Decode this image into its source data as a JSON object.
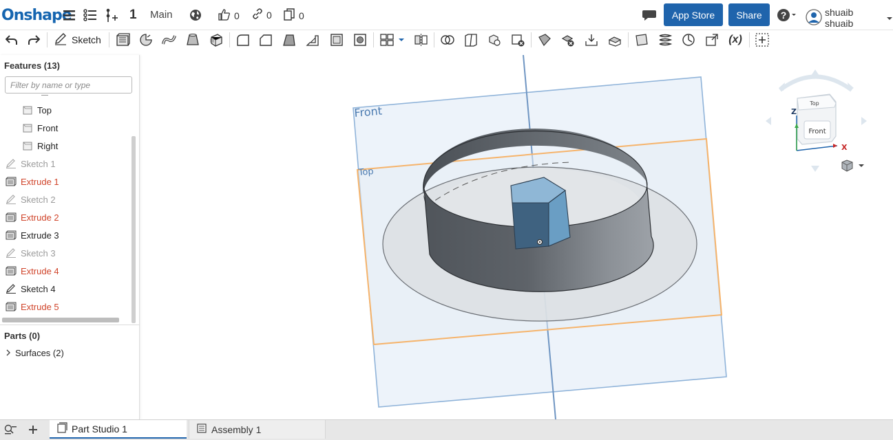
{
  "topbar": {
    "logo": "Onshape",
    "version_count": "1",
    "branch": "Main",
    "likes": "0",
    "links": "0",
    "copies": "0",
    "app_store_label": "App Store",
    "share_label": "Share",
    "user_name": "shuaib shuaib"
  },
  "toolbar": {
    "sketch_label": "Sketch",
    "tools": [
      "undo-icon",
      "redo-icon",
      "plane-icon",
      "revolve-icon",
      "sweep-icon",
      "loft-icon",
      "thicken-icon",
      "fillet-icon",
      "chamfer-icon",
      "draft-icon",
      "rib-icon",
      "shell-icon",
      "hole-icon",
      "pattern-icon",
      "mirror-icon",
      "boolean-icon",
      "split-icon",
      "transform-icon",
      "delete-part-icon",
      "modify-fillet-icon",
      "delete-face-icon",
      "move-face-icon",
      "replace-face-icon",
      "plane-tool-icon",
      "helix-icon",
      "mate-connector-icon",
      "import-icon",
      "variable-icon",
      "add-custom-feature-icon"
    ]
  },
  "panel": {
    "features_title": "Features (13)",
    "filter_placeholder": "Filter by name or type",
    "planes": [
      {
        "label": "Top"
      },
      {
        "label": "Front"
      },
      {
        "label": "Right"
      }
    ],
    "features": [
      {
        "label": "Sketch 1",
        "kind": "sketch",
        "color": "#9a9a9a"
      },
      {
        "label": "Extrude 1",
        "kind": "extrude",
        "color": "#d0442a"
      },
      {
        "label": "Sketch 2",
        "kind": "sketch",
        "color": "#9a9a9a"
      },
      {
        "label": "Extrude 2",
        "kind": "extrude",
        "color": "#d0442a"
      },
      {
        "label": "Extrude 3",
        "kind": "extrude",
        "color": "#222222"
      },
      {
        "label": "Sketch 3",
        "kind": "sketch",
        "color": "#9a9a9a"
      },
      {
        "label": "Extrude 4",
        "kind": "extrude",
        "color": "#d0442a"
      },
      {
        "label": "Sketch 4",
        "kind": "sketch",
        "color": "#222222"
      },
      {
        "label": "Extrude 5",
        "kind": "extrude",
        "color": "#d0442a"
      }
    ],
    "parts_title": "Parts (0)",
    "surfaces_label": "Surfaces (2)"
  },
  "viewport": {
    "front_plane_label": "Front",
    "top_plane_label": "Top",
    "viewcube_top": "Top",
    "viewcube_front": "Front",
    "axis_z": "Z",
    "axis_x": "X"
  },
  "tabs": [
    {
      "label": "Part Studio 1",
      "active": true
    },
    {
      "label": "Assembly 1",
      "active": false
    }
  ],
  "colors": {
    "brand_blue": "#1f64ac",
    "error_red": "#d0442a",
    "plane_blue": "#8fb3d9",
    "plane_orange": "#f6b36a"
  }
}
